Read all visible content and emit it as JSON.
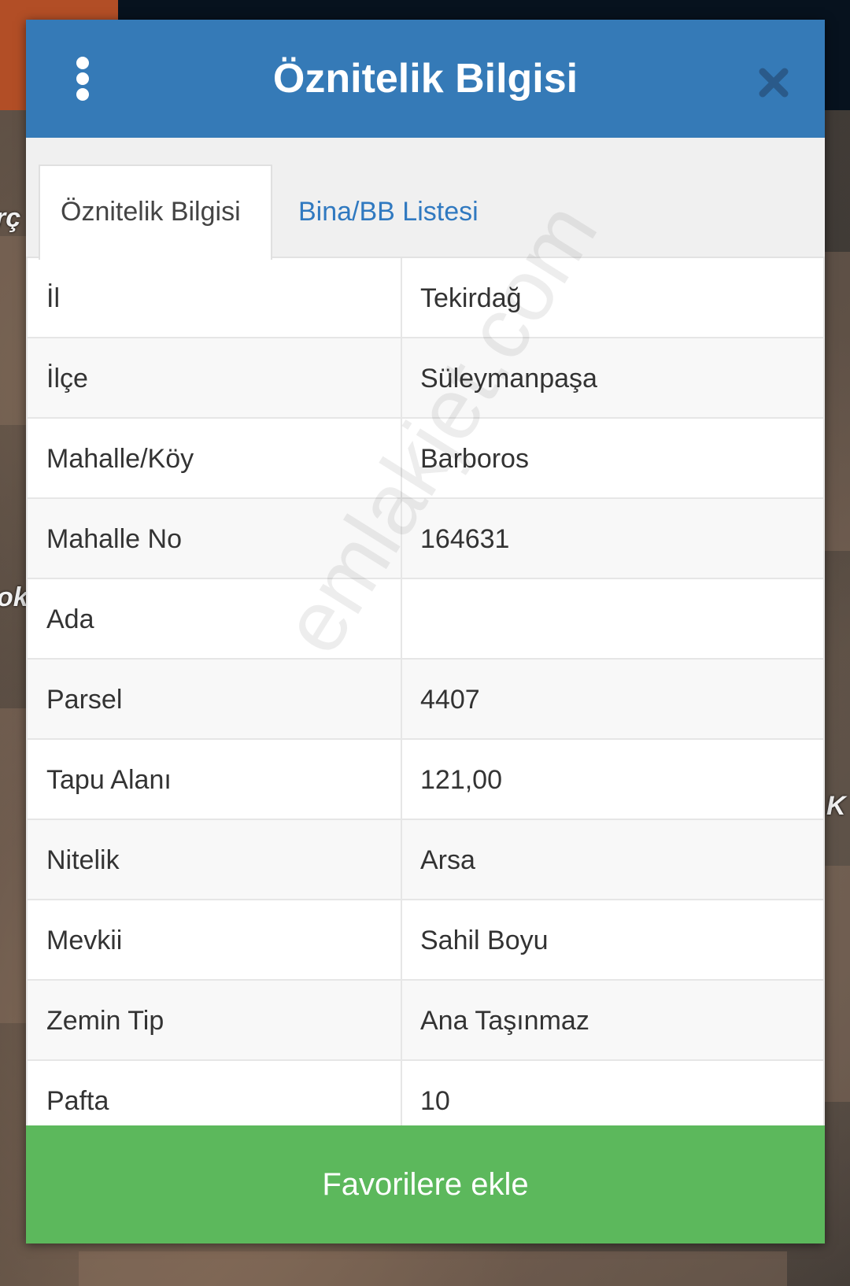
{
  "background": {
    "map_labels": [
      "rç",
      "ok",
      "K"
    ]
  },
  "dialog": {
    "title": "Öznitelik Bilgisi",
    "menu_icon": "more-vert-icon",
    "close_icon": "close-icon"
  },
  "tabs": [
    {
      "label": "Öznitelik Bilgisi",
      "active": true
    },
    {
      "label": "Bina/BB Listesi",
      "active": false
    }
  ],
  "attributes": [
    {
      "label": "İl",
      "value": "Tekirdağ"
    },
    {
      "label": "İlçe",
      "value": "Süleymanpaşa"
    },
    {
      "label": "Mahalle/Köy",
      "value": "Barboros"
    },
    {
      "label": "Mahalle No",
      "value": "164631"
    },
    {
      "label": "Ada",
      "value": ""
    },
    {
      "label": "Parsel",
      "value": "4407"
    },
    {
      "label": "Tapu Alanı",
      "value": "121,00"
    },
    {
      "label": "Nitelik",
      "value": "Arsa"
    },
    {
      "label": "Mevkii",
      "value": "Sahil Boyu"
    },
    {
      "label": "Zemin Tip",
      "value": "Ana Taşınmaz"
    },
    {
      "label": "Pafta",
      "value": "10"
    }
  ],
  "favorite_button": {
    "label": "Favorilere ekle"
  },
  "watermark": "emlakjet.com",
  "colors": {
    "header": "#357ab7",
    "tab_link": "#3079c0",
    "button": "#5cb85c"
  }
}
